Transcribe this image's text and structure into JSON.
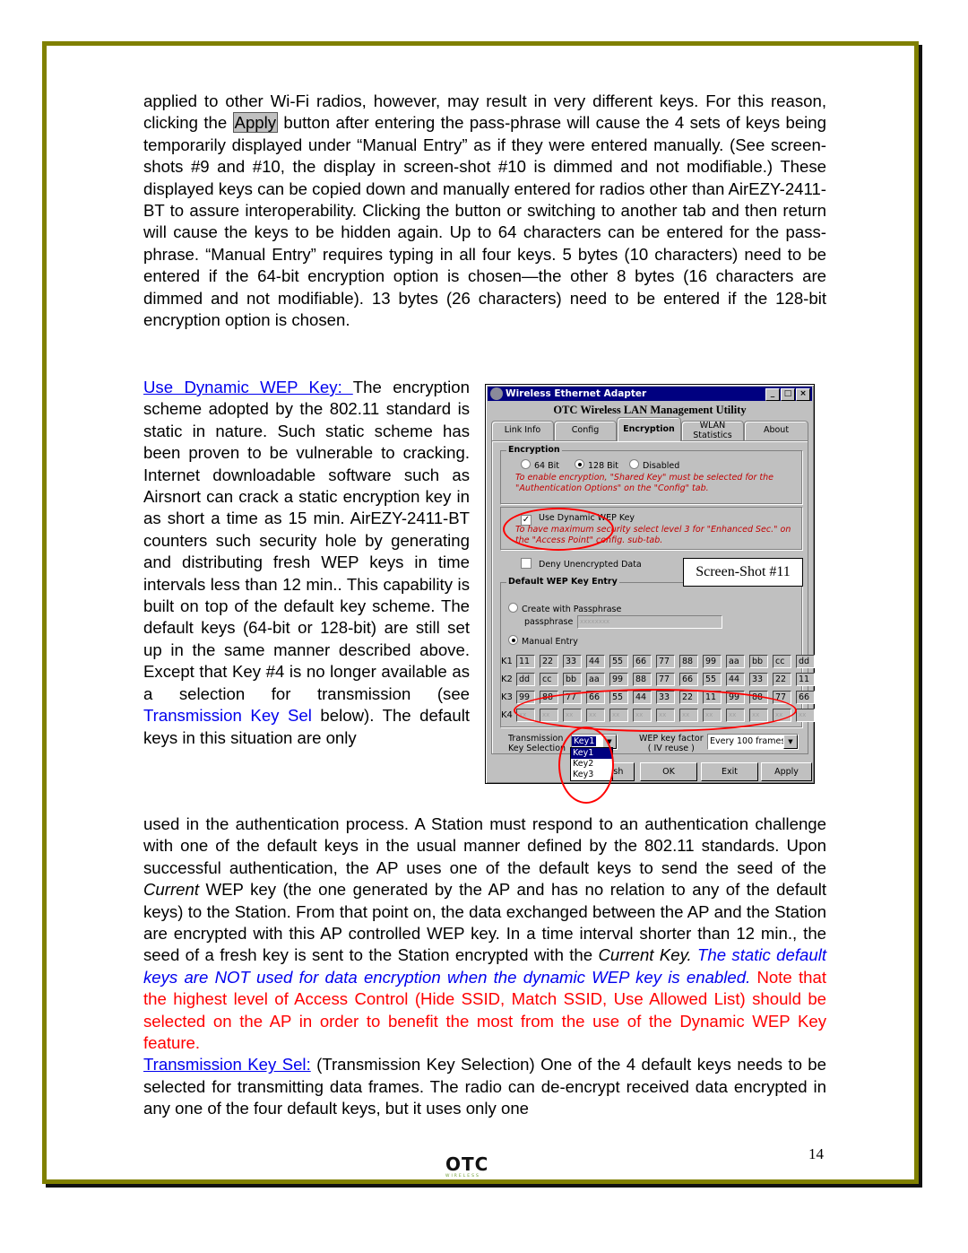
{
  "paragraph1": {
    "part1": "applied to other Wi-Fi radios, however, may result in very different keys. For this reason, clicking the ",
    "apply_button_label": "Apply",
    "part2": " button after entering the pass-phrase will cause the 4 sets of keys being temporarily displayed under “Manual Entry” as if they were entered manually. (See screen-shots #9 and #10, the display in screen-shot #10 is dimmed and not modifiable.) These displayed keys can be copied down and manually entered for radios other than AirEZY-2411-BT to assure interoperability. Clicking the button or switching to another tab and then return will cause the keys to be hidden again. Up to 64 characters can be entered for the pass-phrase. “Manual Entry” requires typing in all four keys. 5 bytes (10 characters) need to be entered if the 64-bit encryption option is chosen—the other 8 bytes (16 characters are dimmed and not modifiable). 13 bytes (26 characters) need to be entered if the 128-bit encryption option is chosen."
  },
  "paragraph2": {
    "heading_link": "Use Dynamic WEP Key: ",
    "text1": "The encryption scheme adopted by the 802.11 standard is static in nature. Such static scheme has been proven to be vulnerable to cracking. Internet downloadable software such as Airsnort can crack a static encryption key in as short a time as 15 min. AirEZY-2411-BT counters such security hole by generating and distributing fresh WEP keys in time intervals less than 12 min.. This capability is built on top of the default key scheme. The default keys (64-bit or 128-bit) are still set up in the same manner described above. Except that Key #4 is no longer available as a selection for transmission (see ",
    "ref_blue": "Transmission Key Sel",
    "text2": " below). The default keys in this situation are only"
  },
  "paragraph3": {
    "text1": "used in the authentication process. A Station must respond to an authentication challenge with one of the default keys in the usual manner defined by the 802.11 standards. Upon successful authentication, the AP uses one of the default keys to send the seed of the ",
    "italic1": "Current",
    "text2": " WEP key (the one generated by the AP and has no relation to any of the default keys) to the Station. From that point on, the data exchanged between the AP and the Station are encrypted with this AP controlled WEP key.  In a time interval shorter than 12 min., the seed of a fresh key is sent to the Station encrypted with the ",
    "italic2": "Current Key.",
    "blue_italic": " The static default keys are NOT used for data encryption when the dynamic WEP key is enabled.",
    "red_text": " Note that the highest level of Access Control (Hide SSID, Match SSID, Use Allowed List) should be selected on the AP in order to benefit the most from the use of the Dynamic WEP Key feature.",
    "link2": "Transmission Key Sel:",
    "text3": " (Transmission Key Selection) One of the 4 default keys needs to be selected for transmitting data frames. The radio can de-encrypt received data encrypted in any one of the four default keys, but it uses only one"
  },
  "screenshot": {
    "window_title": "Wireless Ethernet Adapter",
    "title_buttons": [
      "_",
      "□",
      "×"
    ],
    "app_title": "OTC Wireless LAN Management Utility",
    "tabs": [
      {
        "label": "Link Info"
      },
      {
        "label": "Config"
      },
      {
        "label": "Encryption",
        "active": true
      },
      {
        "label": "WLAN Statistics"
      },
      {
        "label": "About"
      }
    ],
    "encryption_group": {
      "title": "Encryption",
      "options": [
        "64 Bit",
        "128 Bit",
        "Disabled"
      ],
      "selected": "128 Bit",
      "warning": "To enable encryption, \"Shared Key\" must be selected for the \"Authentication Options\" on the \"Config\" tab."
    },
    "dynamic_wep": {
      "label": "Use Dynamic WEP Key",
      "checked": true,
      "warning": "To have maximum security select level 3 for \"Enhanced Sec.\" on the \"Access Point\" config. sub-tab."
    },
    "deny_unencrypted": {
      "label": "Deny Unencrypted Data",
      "checked": false
    },
    "default_key_group": {
      "title": "Default WEP Key Entry",
      "passphrase_option": "Create with Passphrase",
      "passphrase_label": "passphrase",
      "passphrase_value": "xxxxxxxx",
      "manual_option": "Manual Entry",
      "selected": "Manual Entry",
      "keys": [
        {
          "label": "K1",
          "values": [
            "11",
            "22",
            "33",
            "44",
            "55",
            "66",
            "77",
            "88",
            "99",
            "aa",
            "bb",
            "cc",
            "dd"
          ],
          "dimmed": false
        },
        {
          "label": "K2",
          "values": [
            "dd",
            "cc",
            "bb",
            "aa",
            "99",
            "88",
            "77",
            "66",
            "55",
            "44",
            "33",
            "22",
            "11"
          ],
          "dimmed": false
        },
        {
          "label": "K3",
          "values": [
            "99",
            "88",
            "77",
            "66",
            "55",
            "44",
            "33",
            "22",
            "11",
            "99",
            "88",
            "77",
            "66"
          ],
          "dimmed": false
        },
        {
          "label": "K4",
          "values": [
            "xx",
            "xx",
            "xx",
            "xx",
            "xx",
            "xx",
            "xx",
            "xx",
            "xx",
            "xx",
            "xx",
            "xx",
            "xx"
          ],
          "dimmed": true
        }
      ]
    },
    "transmission": {
      "label_line1": "Transmission",
      "label_line2": "Key Selection",
      "selected": "Key1",
      "options": [
        "Key1",
        "Key2",
        "Key3"
      ]
    },
    "wep_factor": {
      "label_line1": "WEP key factor",
      "label_line2": "( IV reuse )",
      "selected": "Every 100 frames"
    },
    "buttons": [
      "Refresh",
      "OK",
      "Exit",
      "Apply"
    ],
    "refresh_partial": "esh"
  },
  "screenshot_label": "Screen-Shot #11",
  "footer": {
    "page_number": "14",
    "logo_text": "OTC",
    "logo_subtext": "WIRELESS"
  },
  "colors": {
    "border": "#808000",
    "link": "#0000ee",
    "red": "#ff0000",
    "titlebar": "#000080"
  }
}
